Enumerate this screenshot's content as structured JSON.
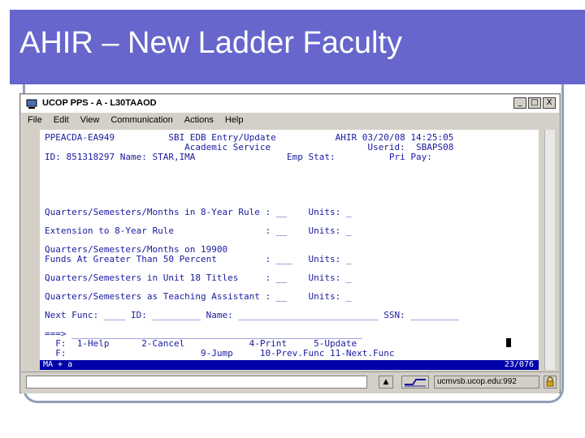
{
  "slide": {
    "title": "AHIR – New Ladder Faculty"
  },
  "window": {
    "title": "UCOP PPS - A - L30TAAOD",
    "buttons": [
      "_",
      "□",
      "X"
    ],
    "menu": [
      "File",
      "Edit",
      "View",
      "Communication",
      "Actions",
      "Help"
    ]
  },
  "terminal": {
    "lines": [
      "PPEACDA-EA949          SBI EDB Entry/Update           AHIR 03/20/08 14:25:05",
      "                          Academic Service                  Userid:  SBAPS08",
      "ID: 851318297 Name: STAR,IMA                 Emp Stat:          Pri Pay:",
      "",
      "",
      "",
      "Quarters/Semesters/Months in 8-Year Rule : __    Units: _",
      "",
      "Extension to 8-Year Rule                 : __    Units: _",
      "",
      "Quarters/Semesters/Months on 19900",
      "Funds At Greater Than 50 Percent         : ___   Units: _",
      "",
      "Quarters/Semesters in Unit 18 Titles     : __    Units: _",
      "",
      "Quarters/Semesters as Teaching Assistant : __    Units: _",
      "",
      "Next Func: ____ ID: _________ Name: __________________________ SSN: _________",
      "",
      "===> ______________________________________________________",
      "  F:  1-Help      2-Cancel            4-Print     5-Update",
      "  F:                         9-Jump     10-Prev.Func 11-Next.Func"
    ]
  },
  "status": {
    "left": "MA  +   a",
    "right": "23/076"
  },
  "statusbar": {
    "host": "ucmvsb.ucop.edu:992"
  }
}
